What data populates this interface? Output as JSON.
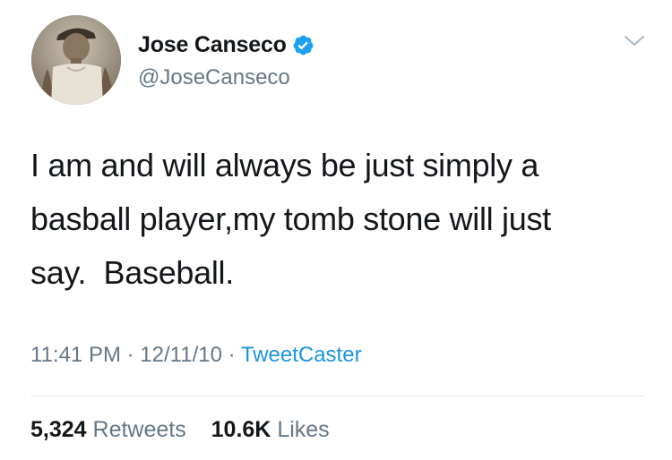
{
  "tweet": {
    "author": {
      "display_name": "Jose Canseco",
      "handle": "@JoseCanseco",
      "verified": true,
      "avatar_icon": "profile-photo"
    },
    "text": "I am and will always be just simply a\nbasball player,my tomb stone will just\nsay.  Baseball.",
    "time": "11:41 PM",
    "date": "12/11/10",
    "separator": "·",
    "source": "TweetCaster",
    "retweets_count": "5,324",
    "retweets_label": "Retweets",
    "likes_count": "10.6K",
    "likes_label": "Likes"
  },
  "colors": {
    "text_primary": "#14171a",
    "text_secondary": "#657786",
    "link": "#1b95e0",
    "verified_badge": "#1da1f2",
    "divider": "#e1e8ed"
  },
  "icons": {
    "verified": "verified-badge-icon",
    "menu": "chevron-down-icon"
  }
}
